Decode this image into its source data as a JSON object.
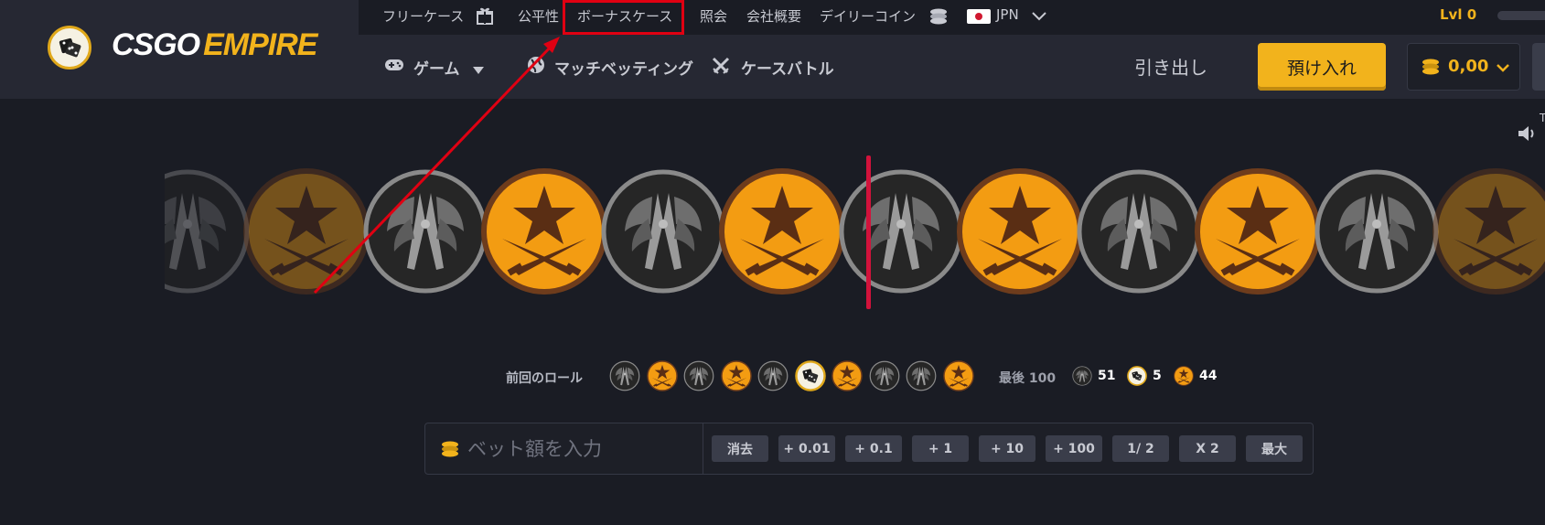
{
  "header": {
    "logo": {
      "part1": "CSGO",
      "part2": "EMPIRE"
    },
    "top_links": {
      "free_case": "フリーケース",
      "fairness": "公平性",
      "bonus_case": "ボーナスケース",
      "reference": "照会",
      "company": "会社概要",
      "daily_coin": "デイリーコイン",
      "language": "JPN"
    },
    "level": "Lvl 0",
    "nav": {
      "games": "ゲーム",
      "match_betting": "マッチベッティング",
      "case_battle": "ケースバトル",
      "withdraw": "引き出し",
      "deposit": "預け入れ",
      "balance": "0,00"
    }
  },
  "roulette": {
    "strip": [
      "ct",
      "t",
      "ct",
      "t",
      "ct",
      "t",
      "ct",
      "t",
      "ct",
      "t",
      "ct",
      "t"
    ],
    "sound_hint": "T"
  },
  "history": {
    "prev_label": "前回のロール",
    "prev_rolls": [
      "ct",
      "t",
      "ct",
      "t",
      "ct",
      "bonus",
      "t",
      "ct",
      "ct",
      "t"
    ],
    "last_label": "最後 100",
    "counts": {
      "ct": "51",
      "bonus": "5",
      "t": "44"
    }
  },
  "bet": {
    "placeholder": "ベット額を入力",
    "buttons": [
      "消去",
      "+ 0.01",
      "+ 0.1",
      "+ 1",
      "+ 10",
      "+ 100",
      "1/ 2",
      "X 2",
      "最大"
    ]
  },
  "colors": {
    "accent": "#f2b31c",
    "marker": "#d2123b",
    "annotation": "#e00012"
  },
  "icons": {
    "t_coin": "crossed-knives-star-icon",
    "ct_coin": "winged-pliers-icon",
    "bonus_coin": "dice-icon"
  }
}
